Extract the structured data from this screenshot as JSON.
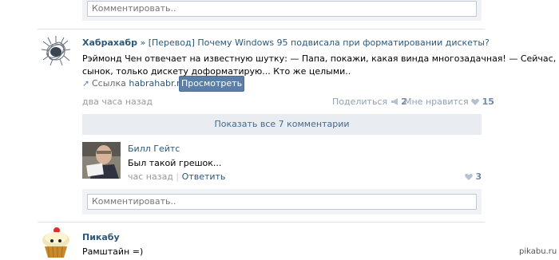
{
  "top_comment": {
    "placeholder": "Комментировать.."
  },
  "post": {
    "author": "Хабрахабр",
    "title": "» [Перевод] Почему Windows 95 подвисала при форматировании дискеты?",
    "text_line1": "Рэймонд Чен отвечает на известную шутку: — Папа, покажи, какая винда многозадачная! — Сейчас,",
    "text_line2": "сынок, только дискету доформатирую... Кто же целыми..",
    "link_label": "Ссылка",
    "link_domain": "habrahabr.ru",
    "view_button": "Просмотреть",
    "time": "два часа назад",
    "share_label": "Поделиться",
    "share_count": "2",
    "like_label": "Мне нравится",
    "like_count": "15"
  },
  "comments": {
    "show_all": "Показать все 7 комментарии",
    "item": {
      "author": "Билл Гейтс",
      "text": "Был такой грешок...",
      "time": "час назад",
      "separator": "|",
      "reply": "Ответить",
      "likes": "3"
    },
    "input_placeholder": "Комментировать.."
  },
  "next_post": {
    "author": "Пикабу",
    "text": "Рамштайн =)"
  },
  "watermark": "pikabu.ru"
}
